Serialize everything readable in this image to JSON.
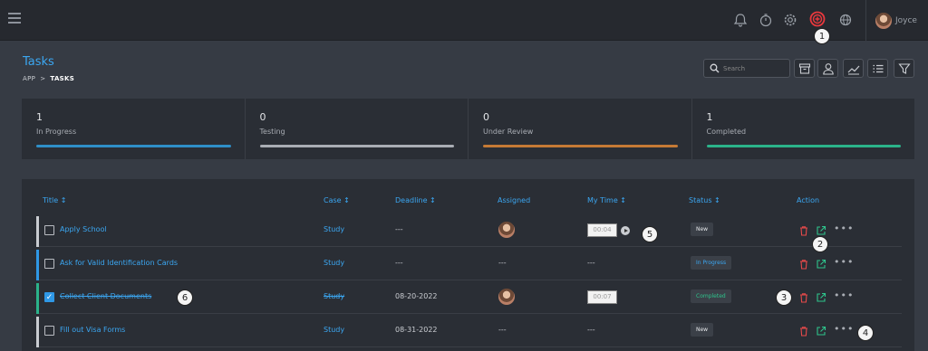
{
  "topbar": {
    "user_name": "Joyce"
  },
  "page": {
    "title": "Tasks",
    "breadcrumb_root": "APP",
    "breadcrumb_current": "TASKS"
  },
  "toolbar": {
    "search_placeholder": "Search"
  },
  "stats": [
    {
      "count": "1",
      "label": "In Progress",
      "color": "#2f8fc8"
    },
    {
      "count": "0",
      "label": "Testing",
      "color": "#a9adb4"
    },
    {
      "count": "0",
      "label": "Under Review",
      "color": "#c57a35"
    },
    {
      "count": "1",
      "label": "Completed",
      "color": "#2bb38a"
    }
  ],
  "table": {
    "headers": {
      "title": "Title ↕",
      "case": "Case ↕",
      "deadline": "Deadline ↕",
      "assigned": "Assigned",
      "mytime": "My Time ↕",
      "status": "Status ↕",
      "action": "Action"
    },
    "rows": [
      {
        "title": "Apply School",
        "case": "Study",
        "deadline": "---",
        "assigned": "avatar",
        "time": "00:04",
        "status": "New",
        "checked": false
      },
      {
        "title": "Ask for Valid Identification Cards",
        "case": "Study",
        "deadline": "---",
        "assigned": "---",
        "time": "---",
        "status": "In Progress",
        "checked": false
      },
      {
        "title": "Collect Client Documents",
        "case": "Study",
        "deadline": "08-20-2022",
        "assigned": "avatar",
        "time": "00:07",
        "status": "Completed",
        "checked": true
      },
      {
        "title": "Fill out Visa Forms",
        "case": "Study",
        "deadline": "08-31-2022",
        "assigned": "---",
        "time": "---",
        "status": "New",
        "checked": false
      }
    ]
  },
  "annotations": [
    "1",
    "2",
    "3",
    "4",
    "5",
    "6"
  ],
  "colors": {
    "accent": "#3ba7f2",
    "delete": "#e84a4a",
    "open": "#2ec48c",
    "highlight": "#e8383d"
  }
}
